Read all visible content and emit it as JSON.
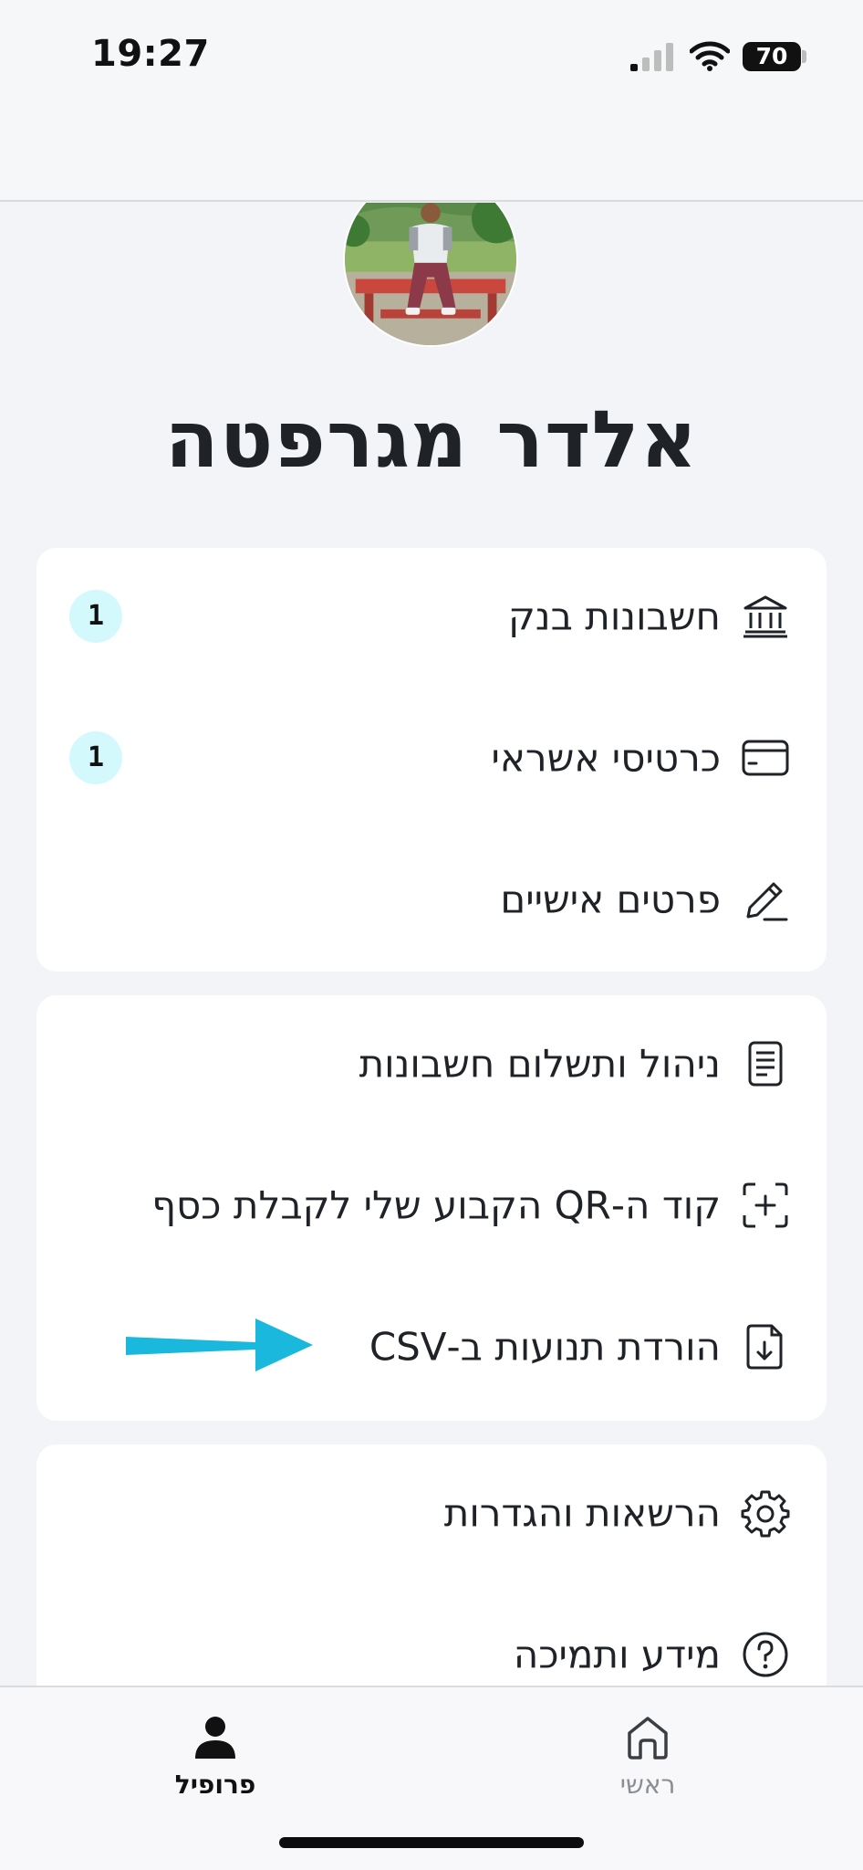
{
  "status_bar": {
    "time": "19:27",
    "battery": "70"
  },
  "profile": {
    "name": "אלדר מגרפטה"
  },
  "menu": {
    "group1": [
      {
        "label": "חשבונות בנק",
        "icon": "bank-icon",
        "badge": "1"
      },
      {
        "label": "כרטיסי אשראי",
        "icon": "credit-card-icon",
        "badge": "1"
      },
      {
        "label": "פרטים אישיים",
        "icon": "pencil-icon"
      }
    ],
    "group2": [
      {
        "label": "ניהול ותשלום חשבונות",
        "icon": "document-icon"
      },
      {
        "label": "קוד ה-QR הקבוע שלי לקבלת כסף",
        "icon": "qr-scan-icon"
      },
      {
        "label": "הורדת תנועות ב-CSV",
        "icon": "file-download-icon"
      }
    ],
    "group3": [
      {
        "label": "הרשאות והגדרות",
        "icon": "gear-icon"
      },
      {
        "label": "מידע ותמיכה",
        "icon": "help-icon"
      }
    ]
  },
  "tab_bar": {
    "profile_label": "פרופיל",
    "home_label": "ראשי"
  },
  "colors": {
    "badge_bg": "#d4f9fd",
    "annotation_arrow": "#1ab8dc",
    "background": "#f3f4f7"
  }
}
